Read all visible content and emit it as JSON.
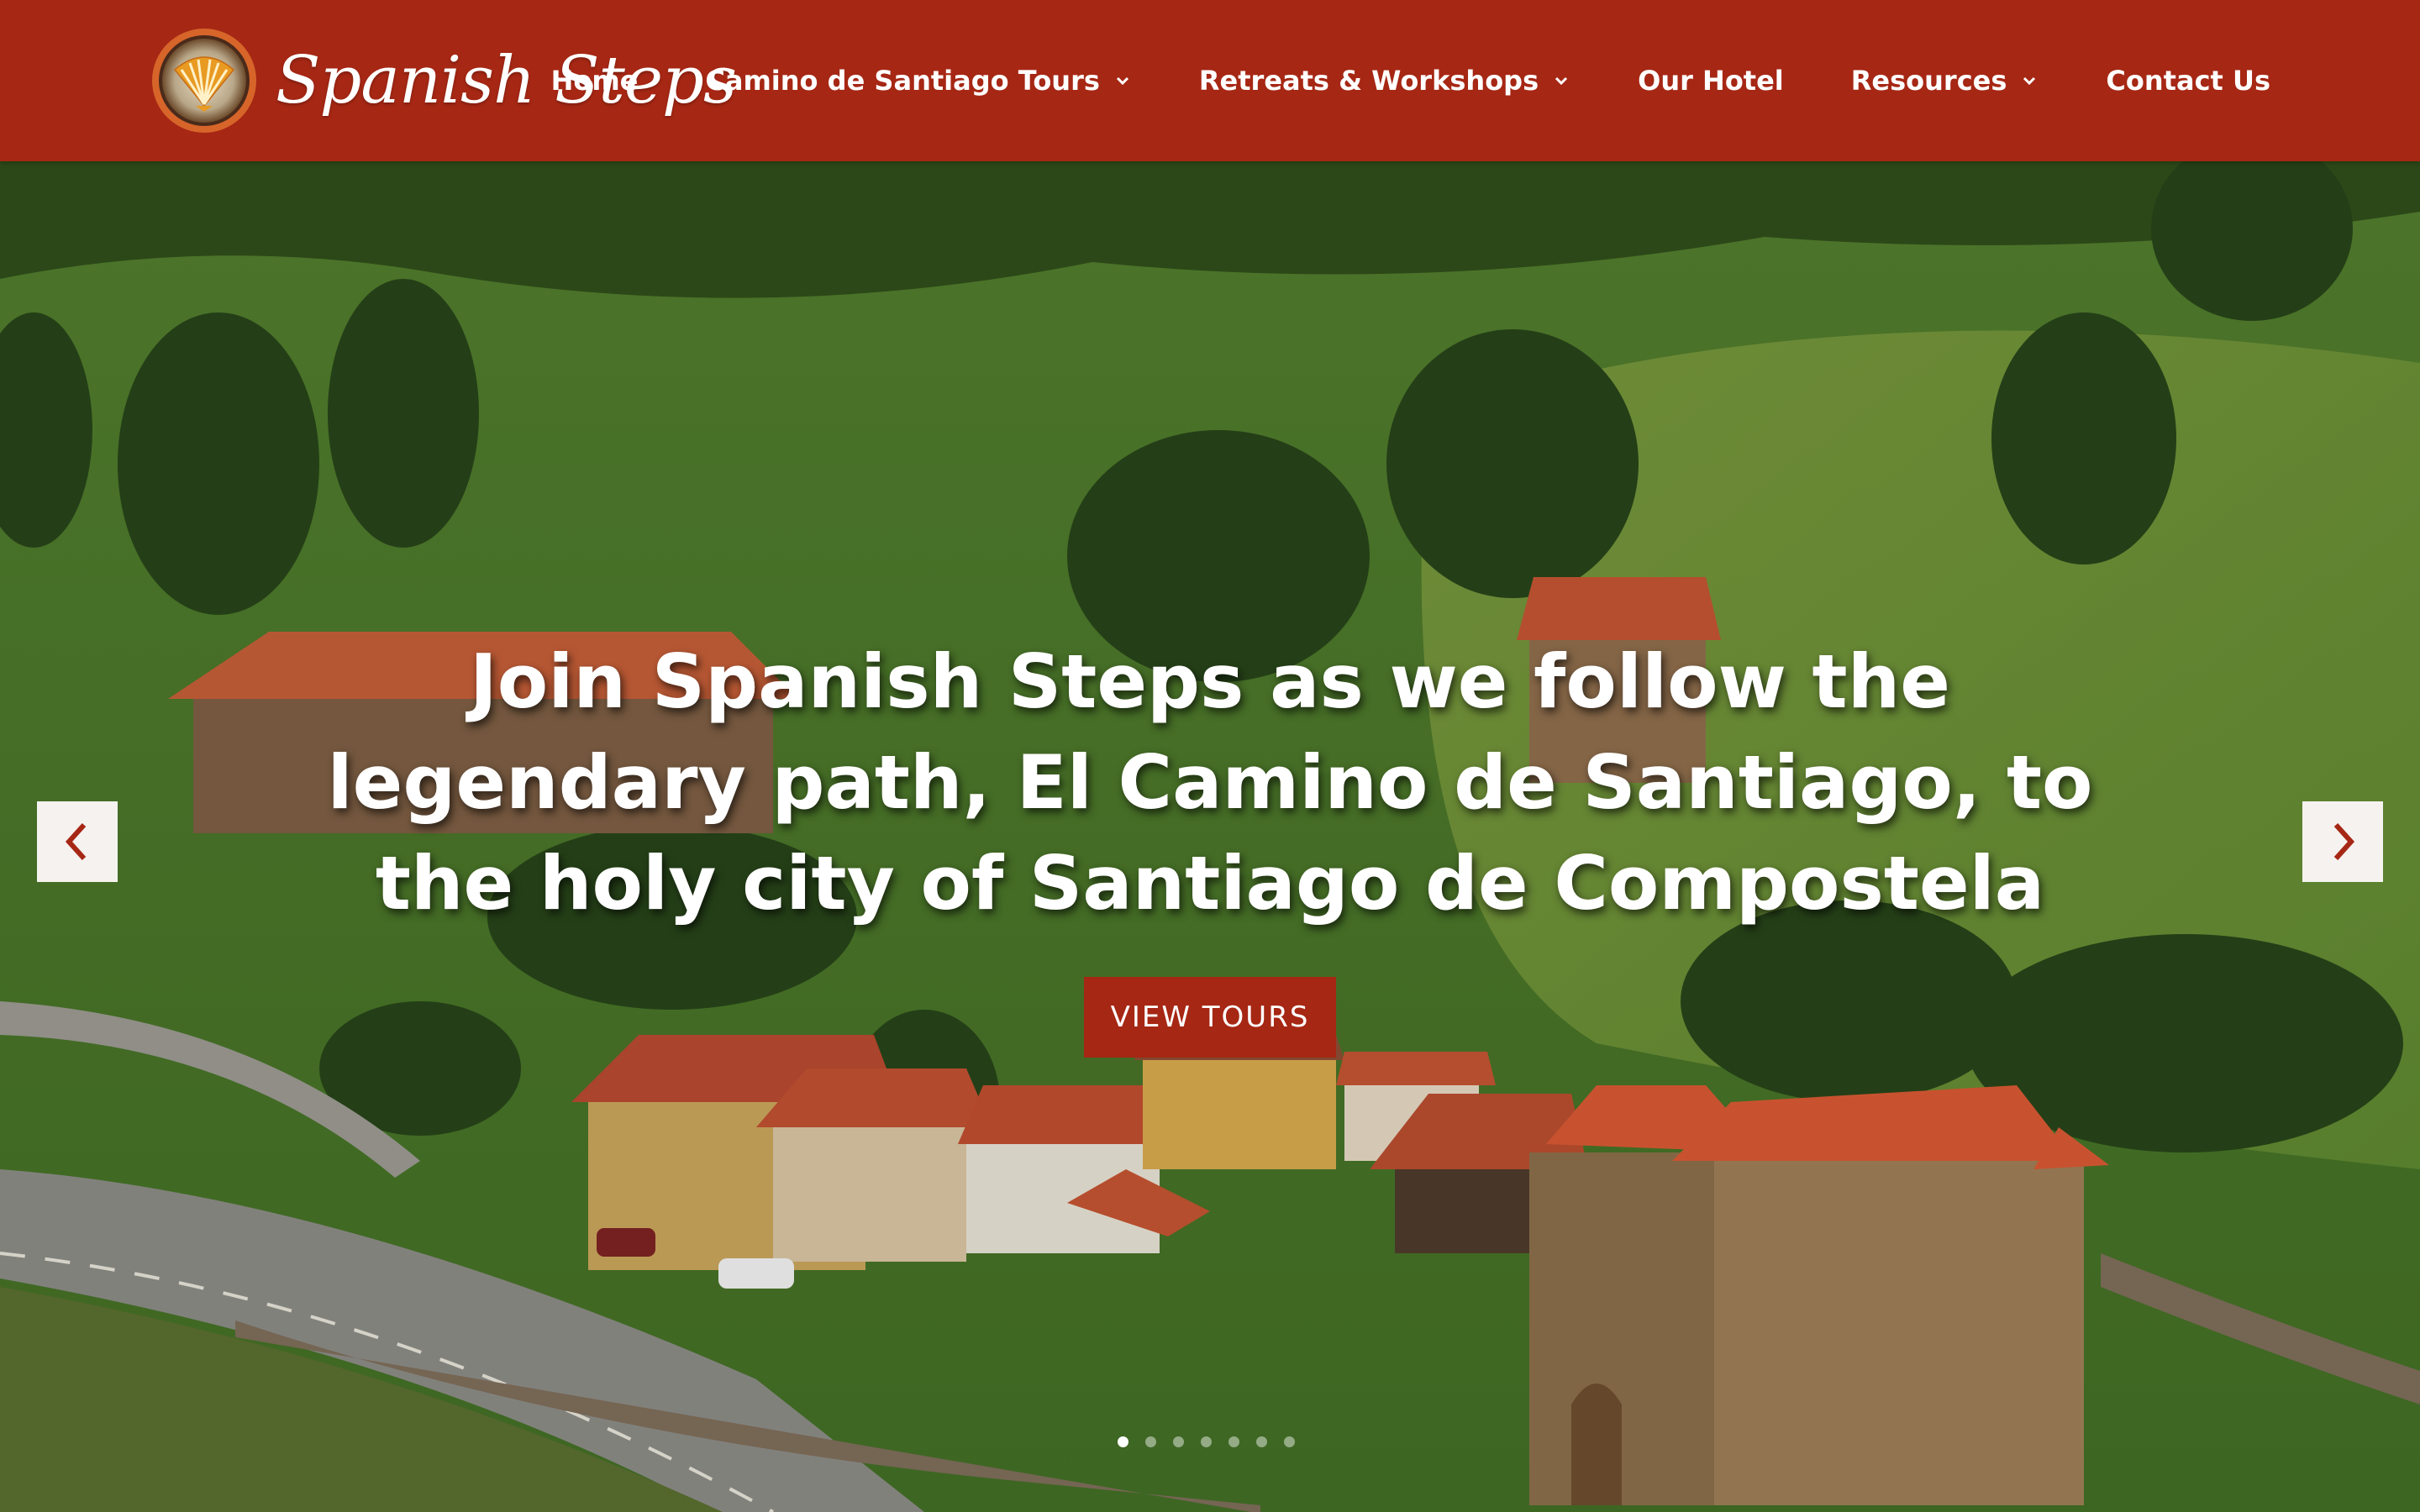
{
  "brand": {
    "name": "Spanish Steps",
    "emblem_icon": "scallop-shell-icon"
  },
  "nav": {
    "items": [
      {
        "label": "Home",
        "has_dropdown": false
      },
      {
        "label": "Camino de Santiago Tours",
        "has_dropdown": true
      },
      {
        "label": "Retreats & Workshops",
        "has_dropdown": true
      },
      {
        "label": "Our Hotel",
        "has_dropdown": false
      },
      {
        "label": "Resources",
        "has_dropdown": true
      },
      {
        "label": "Contact Us",
        "has_dropdown": false
      }
    ]
  },
  "hero": {
    "headline": "Join Spanish Steps as we follow the legendary path, El Camino de Santiago, to the holy city of Santiago de Compostela",
    "cta_label": "VIEW TOURS",
    "prev_icon": "chevron-left-icon",
    "next_icon": "chevron-right-icon",
    "slide_count": 7,
    "active_slide": 1
  },
  "colors": {
    "brand_red": "#a62714",
    "header_text": "#ffffff",
    "arrow_bg": "#f5f2ef"
  }
}
